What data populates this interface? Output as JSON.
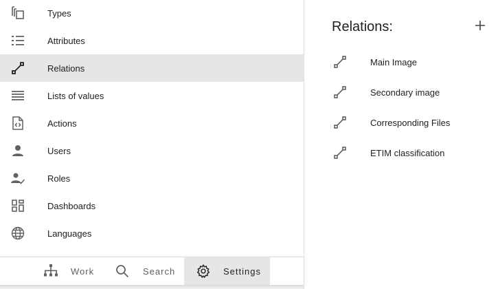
{
  "sidebar": {
    "items": [
      {
        "label": "Types",
        "icon": "copy-stack-icon"
      },
      {
        "label": "Attributes",
        "icon": "list-bulleted-icon"
      },
      {
        "label": "Relations",
        "icon": "relation-link-icon",
        "active": true
      },
      {
        "label": "Lists of values",
        "icon": "lines-icon"
      },
      {
        "label": "Actions",
        "icon": "code-file-icon"
      },
      {
        "label": "Users",
        "icon": "person-icon"
      },
      {
        "label": "Roles",
        "icon": "person-check-icon"
      },
      {
        "label": "Dashboards",
        "icon": "dashboard-icon"
      },
      {
        "label": "Languages",
        "icon": "globe-icon"
      }
    ]
  },
  "bottom_nav": {
    "work": "Work",
    "search": "Search",
    "settings": "Settings",
    "active": "settings"
  },
  "panel": {
    "title": "Relations:",
    "add_icon": "plus-icon",
    "relations": [
      {
        "label": "Main Image"
      },
      {
        "label": "Secondary image"
      },
      {
        "label": "Corresponding Files"
      },
      {
        "label": "ETIM classification"
      }
    ]
  },
  "colors": {
    "active_background": "#e6e6e6",
    "icon_gray": "#616161",
    "divider": "#e0e0e0"
  }
}
